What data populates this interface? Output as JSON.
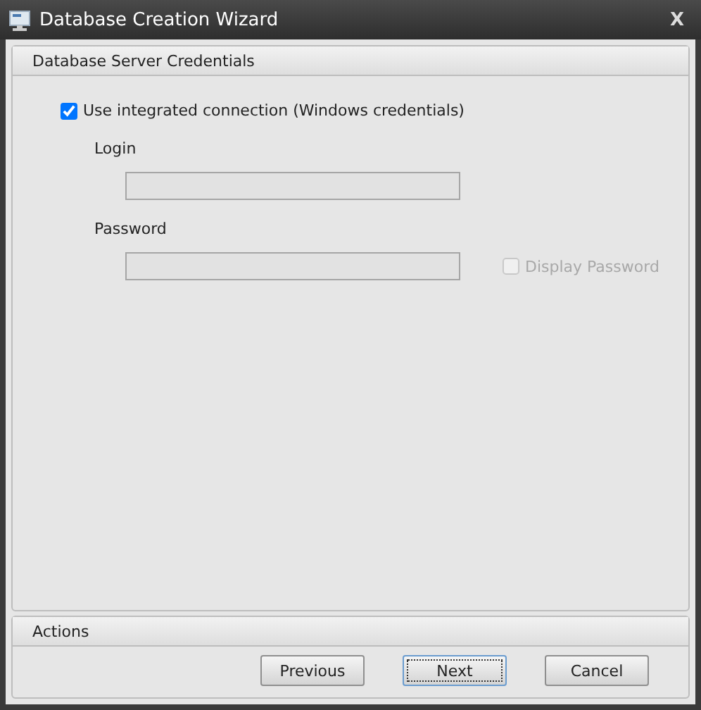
{
  "window": {
    "title": "Database Creation Wizard",
    "close": "X"
  },
  "credentials": {
    "title": "Database Server Credentials",
    "integrated": {
      "label": "Use integrated connection (Windows credentials)",
      "checked": true
    },
    "login": {
      "label": "Login",
      "disabled": true
    },
    "password": {
      "label": "Password",
      "disabled": true
    },
    "display_password": {
      "label": "Display Password",
      "checked": false,
      "disabled": true
    }
  },
  "actions": {
    "title": "Actions",
    "buttons": [
      {
        "label": "Previous",
        "focused": false
      },
      {
        "label": "Next",
        "focused": true
      },
      {
        "label": "Cancel",
        "focused": false
      }
    ]
  }
}
